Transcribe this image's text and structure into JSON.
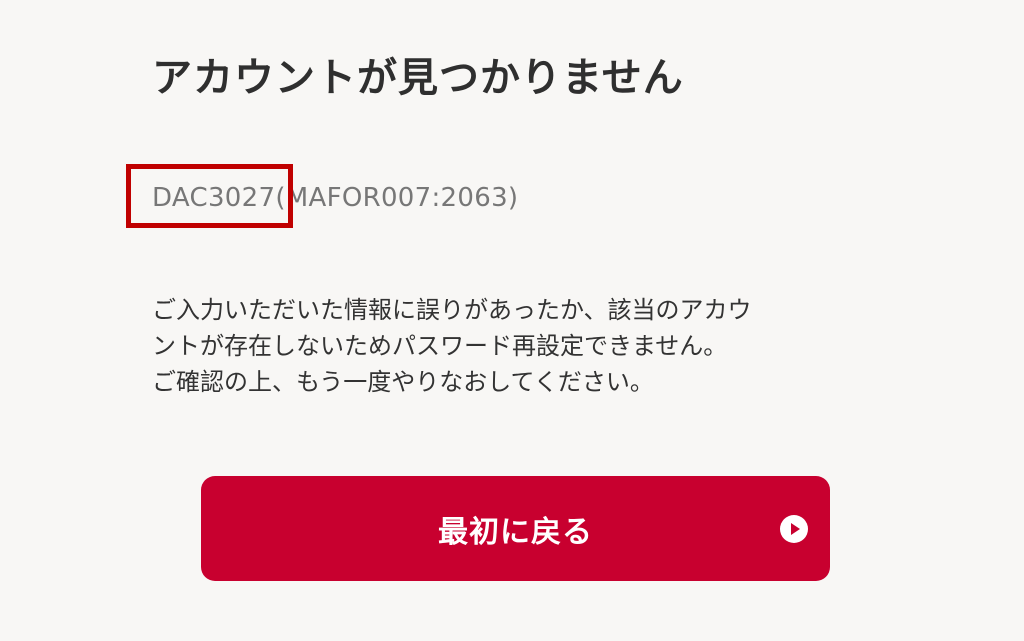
{
  "page": {
    "title": "アカウントが見つかりません",
    "error_code": "DAC3027(MAFOR007:2063)",
    "message_lines": [
      "ご入力いただいた情報に誤りがあったか、該当のアカウ",
      "ントが存在しないためパスワード再設定できません。",
      "ご確認の上、もう一度やりなおしてください。"
    ],
    "back_button_label": "最初に戻る",
    "back_button_icon": "play-circle-icon"
  },
  "colors": {
    "background": "#f8f7f5",
    "button": "#c8002f",
    "highlight": "#c00000",
    "title": "#2f2f2f",
    "code": "#777777"
  }
}
